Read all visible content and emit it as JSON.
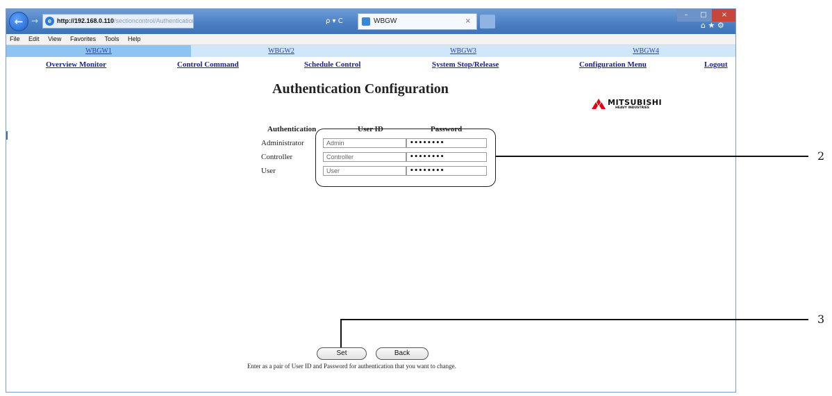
{
  "browser": {
    "address_host": "http://192.168.0.110",
    "address_rest": "/sectioncontrol/Authentication",
    "search_label": "ρ ▾ C",
    "tab_title": "WBGW",
    "tab_close": "×",
    "win_min": "–",
    "win_max": "□",
    "win_close": "×",
    "right_icons": "⌂ ★ ⚙"
  },
  "menu": [
    "File",
    "Edit",
    "View",
    "Favorites",
    "Tools",
    "Help"
  ],
  "gateways": [
    "WBGW1",
    "WBGW2",
    "WBGW3",
    "WBGW4"
  ],
  "nav": {
    "overview": "Overview Monitor",
    "control": "Control Command",
    "schedule": "Schedule Control",
    "system": "System Stop/Release",
    "config": "Configuration Menu",
    "logout": "Logout"
  },
  "page_title": "Authentication Configuration",
  "logo": {
    "name": "MITSUBISHI",
    "sub": "HEAVY INDUSTRIES"
  },
  "table": {
    "headers": [
      "Authentication",
      "User ID",
      "Password"
    ],
    "rows": [
      {
        "label": "Administrator",
        "user_id": "Admin",
        "password": "••••••••"
      },
      {
        "label": "Controller",
        "user_id": "Controller",
        "password": "••••••••"
      },
      {
        "label": "User",
        "user_id": "User",
        "password": "••••••••"
      }
    ]
  },
  "buttons": {
    "set": "Set",
    "back": "Back"
  },
  "hint": "Enter as a pair of User ID and Password for authentication that you want to change.",
  "callouts": [
    "2",
    "3"
  ],
  "colors": {
    "gateway_bar": "#cfe6fb",
    "gateway_active": "#8fc3f2",
    "link": "#1a1aa6",
    "logo_red": "#e60012"
  }
}
